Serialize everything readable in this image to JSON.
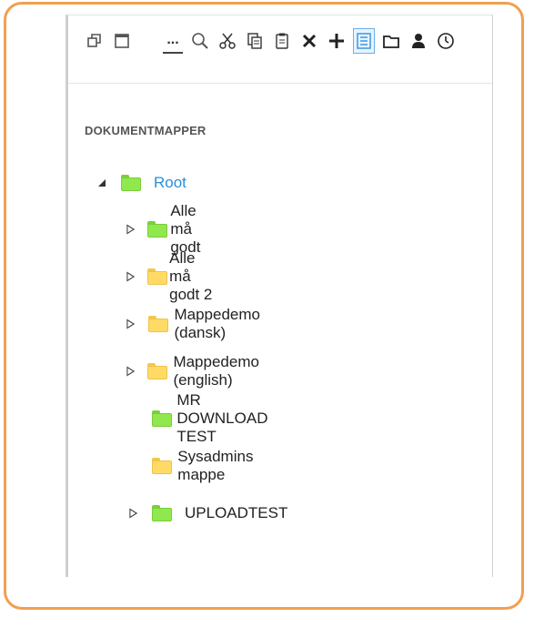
{
  "toolbar": {
    "icons": [
      "restore-window-icon",
      "maximize-window-icon",
      "more-icon",
      "search-icon",
      "cut-icon",
      "copy-icon",
      "paste-icon",
      "delete-icon",
      "add-icon",
      "list-view-icon",
      "folder-view-icon",
      "user-icon",
      "clock-icon"
    ],
    "more_label": "..."
  },
  "section": {
    "title": "DOKUMENTMAPPER"
  },
  "tree": {
    "root": {
      "label": "Root",
      "color": "green",
      "expanded": true
    },
    "children": [
      {
        "label": "Alle må godt",
        "color": "green",
        "has_children": true
      },
      {
        "label": "Alle må godt 2",
        "color": "yellow",
        "has_children": true
      },
      {
        "label": "Mappedemo (dansk)",
        "color": "yellow",
        "has_children": true
      },
      {
        "label": "Mappedemo (english)",
        "color": "yellow",
        "has_children": true
      },
      {
        "label": "MR DOWNLOAD TEST",
        "color": "green",
        "has_children": false
      },
      {
        "label": "Sysadmins mappe",
        "color": "yellow",
        "has_children": false
      },
      {
        "label": "UPLOADTEST",
        "color": "green",
        "has_children": true
      }
    ]
  },
  "colors": {
    "frame": "#f0a050",
    "root_link": "#2a8fd6",
    "folder_green": "#90e84e",
    "folder_yellow": "#ffdb65"
  }
}
